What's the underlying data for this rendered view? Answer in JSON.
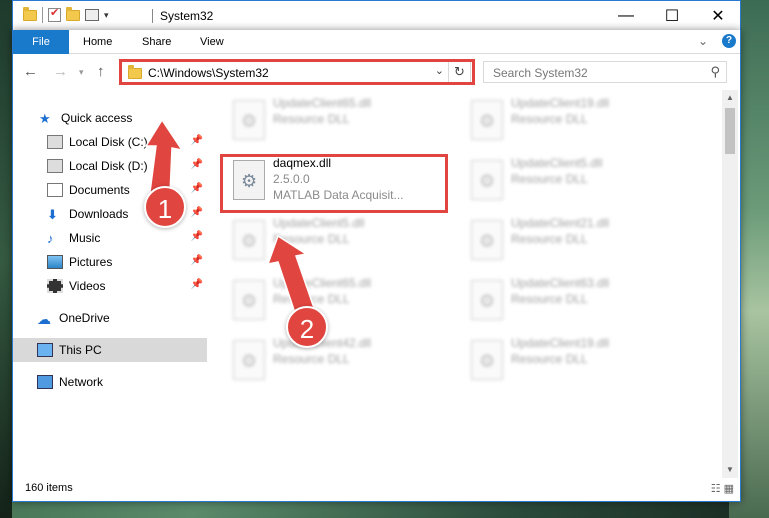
{
  "window": {
    "title": "System32"
  },
  "ribbon": {
    "tabs": [
      "File",
      "Home",
      "Share",
      "View"
    ],
    "help": "?"
  },
  "address": {
    "path": "C:\\Windows\\System32"
  },
  "search": {
    "placeholder": "Search System32"
  },
  "sidebar": {
    "items": [
      {
        "label": "Quick access",
        "icon": "star-icon"
      },
      {
        "label": "Local Disk (C:)",
        "icon": "drive-icon"
      },
      {
        "label": "Local Disk (D:)",
        "icon": "drive-icon"
      },
      {
        "label": "Documents",
        "icon": "document-icon"
      },
      {
        "label": "Downloads",
        "icon": "download-icon"
      },
      {
        "label": "Music",
        "icon": "music-icon"
      },
      {
        "label": "Pictures",
        "icon": "pictures-icon"
      },
      {
        "label": "Videos",
        "icon": "videos-icon"
      },
      {
        "label": "OneDrive",
        "icon": "onedrive-icon"
      },
      {
        "label": "This PC",
        "icon": "this-pc-icon"
      },
      {
        "label": "Network",
        "icon": "network-icon"
      }
    ]
  },
  "files": [
    {
      "name": "UpdateClient65.dll",
      "type": "Resource DLL"
    },
    {
      "name": "UpdateClient19.dll",
      "type": "Resource DLL"
    },
    {
      "name": "daqmex.dll",
      "version": "2.5.0.0",
      "type": "MATLAB Data Acquisit..."
    },
    {
      "name": "UpdateClient5.dll",
      "type": "Resource DLL"
    },
    {
      "name": "UpdateClient5.dll",
      "type": "Resource DLL"
    },
    {
      "name": "UpdateClient21.dll",
      "type": "Resource DLL"
    },
    {
      "name": "UpdateClient65.dll",
      "type": "Resource DLL"
    },
    {
      "name": "UpdateClient63.dll",
      "type": "Resource DLL"
    },
    {
      "name": "UpdateClient42.dll",
      "type": "Resource DLL"
    },
    {
      "name": "UpdateClient19.dll",
      "type": "Resource DLL"
    }
  ],
  "status": {
    "count": "160 items"
  },
  "annotations": {
    "step1": "1",
    "step2": "2",
    "color": "#e0453f"
  }
}
